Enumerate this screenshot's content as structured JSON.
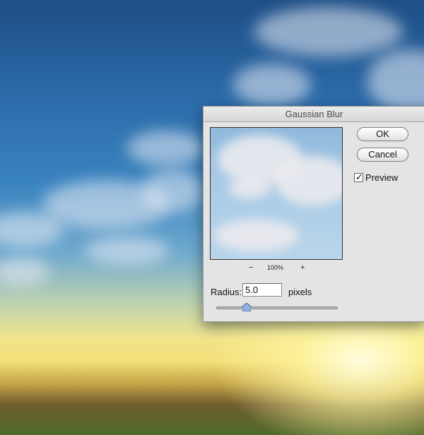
{
  "dialog": {
    "title": "Gaussian Blur",
    "ok_label": "OK",
    "cancel_label": "Cancel",
    "preview_label": "Preview",
    "preview_checked": true,
    "zoom": {
      "out_label": "−",
      "level": "100%",
      "in_label": "+"
    },
    "radius": {
      "label": "Radius:",
      "value": "5.0",
      "units": "pixels"
    },
    "slider": {
      "fraction": 0.25
    }
  },
  "colors": {
    "slider_thumb": "#8fb3e6",
    "dialog_bg": "#e4e4e4"
  },
  "icons": {
    "check": "check-mark-icon"
  }
}
